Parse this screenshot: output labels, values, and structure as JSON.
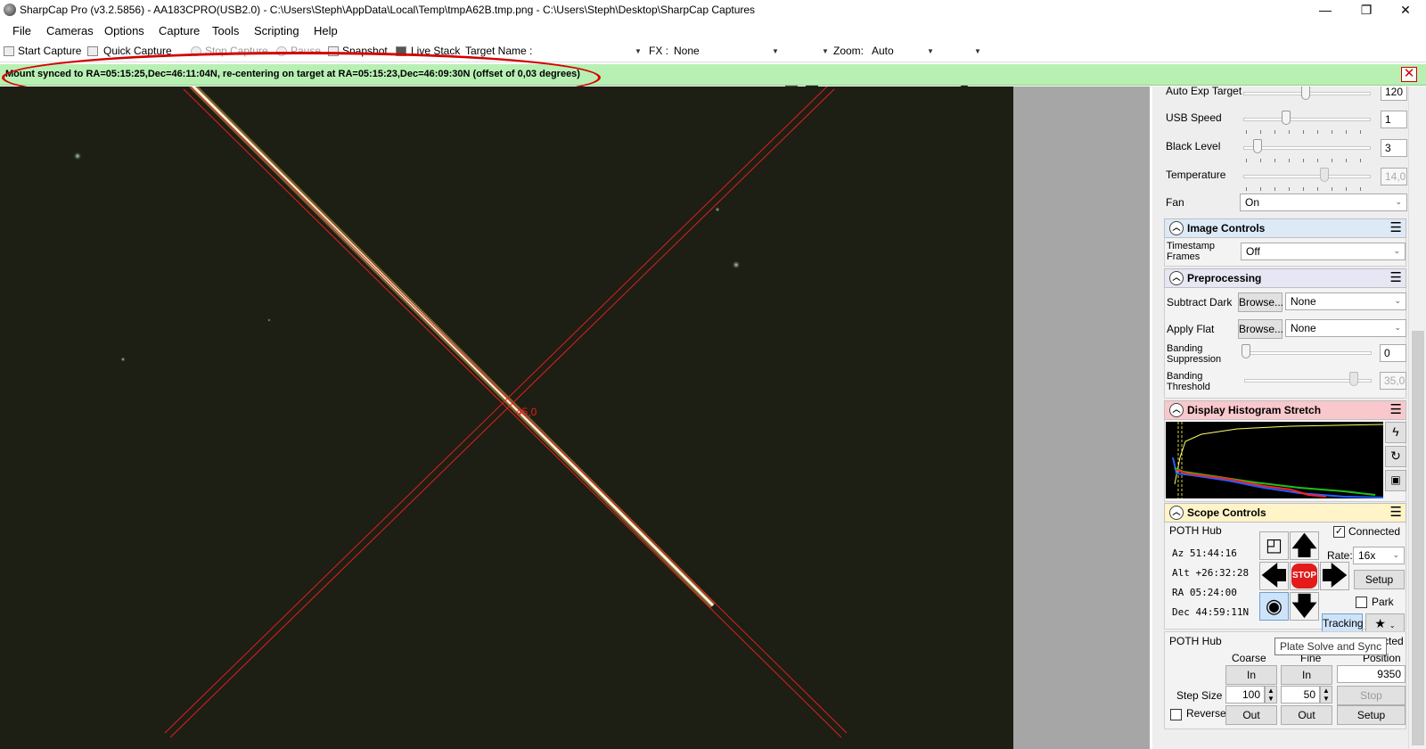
{
  "window": {
    "title": "SharpCap Pro (v3.2.5856) - AA183CPRO(USB2.0) - C:\\Users\\Steph\\AppData\\Local\\Temp\\tmpA62B.tmp.png - C:\\Users\\Steph\\Desktop\\SharpCap Captures",
    "minimize": "—",
    "maximize": "❐",
    "close": "✕"
  },
  "menu": [
    "File",
    "Cameras",
    "Options",
    "Capture",
    "Tools",
    "Scripting",
    "Help"
  ],
  "toolbar": {
    "start_capture": "Start Capture",
    "quick_capture": "Quick Capture",
    "stop_capture": "Stop Capture",
    "pause": "Pause",
    "snapshot": "Snapshot",
    "live_stack": "Live Stack",
    "target_name_label": "Target Name :",
    "target_name_value": "",
    "fx_label": "FX :",
    "fx_value": "None",
    "zoom_label": "Zoom:",
    "zoom_value": "Auto"
  },
  "notification": {
    "message": "Mount synced to RA=05:15:25,Dec=46:11:04N, re-centering on target at RA=05:15:23,Dec=46:09:30N (offset of 0,03 degrees)",
    "close": "✕"
  },
  "viewport": {
    "reticle_angle_label": "45,0"
  },
  "camera_controls": {
    "auto_exp_target": {
      "label": "Auto Exp Target",
      "value": "120",
      "level": 0.5
    },
    "usb_speed": {
      "label": "USB Speed",
      "value": "1",
      "level": 0.35
    },
    "black_level": {
      "label": "Black Level",
      "value": "3",
      "level": 0.1
    },
    "temperature": {
      "label": "Temperature",
      "value": "14,0",
      "level": 0.65
    },
    "fan": {
      "label": "Fan",
      "value": "On"
    }
  },
  "image_controls": {
    "title": "Image Controls",
    "timestamp_frames_label_1": "Timestamp",
    "timestamp_frames_label_2": "Frames",
    "timestamp_frames_value": "Off"
  },
  "preprocessing": {
    "title": "Preprocessing",
    "subtract_dark_label": "Subtract Dark",
    "subtract_dark_button": "Browse...",
    "subtract_dark_value": "None",
    "apply_flat_label": "Apply Flat",
    "apply_flat_button": "Browse...",
    "apply_flat_value": "None",
    "banding_suppression_label_1": "Banding",
    "banding_suppression_label_2": "Suppression",
    "banding_suppression_value": "0",
    "banding_threshold_label_1": "Banding",
    "banding_threshold_label_2": "Threshold",
    "banding_threshold_value": "35,0"
  },
  "histogram": {
    "title": "Display Histogram Stretch",
    "colors": {
      "header": "#f8c8cc",
      "luminance": "#ffff66",
      "red": "#ff2020",
      "green": "#20c020",
      "blue": "#2060ff"
    }
  },
  "scope_controls": {
    "title": "Scope Controls",
    "mount_name": "POTH Hub",
    "connected_label": "Connected",
    "connected_checked": true,
    "az": "Az  51:44:16",
    "alt": "Alt +26:32:28",
    "ra": "RA  05:24:00",
    "dec": "Dec 44:59:11N",
    "rate_label": "Rate:",
    "rate_value": "16x",
    "setup_button": "Setup",
    "stop_label": "STOP",
    "park_label": "Park",
    "tracking_button": "Tracking"
  },
  "focuser": {
    "name": "POTH Hub",
    "connected_fragment": "cted",
    "tooltip": "Plate Solve and Sync",
    "coarse_label": "Coarse",
    "fine_label": "Fine",
    "position_label": "Position",
    "coarse_in": "In",
    "fine_in": "In",
    "position_value": "9350",
    "step_size_label": "Step Size",
    "coarse_step": "100",
    "fine_step": "50",
    "stop_button": "Stop",
    "reverse_label": "Reverse",
    "coarse_out": "Out",
    "fine_out": "Out",
    "setup_button": "Setup"
  }
}
